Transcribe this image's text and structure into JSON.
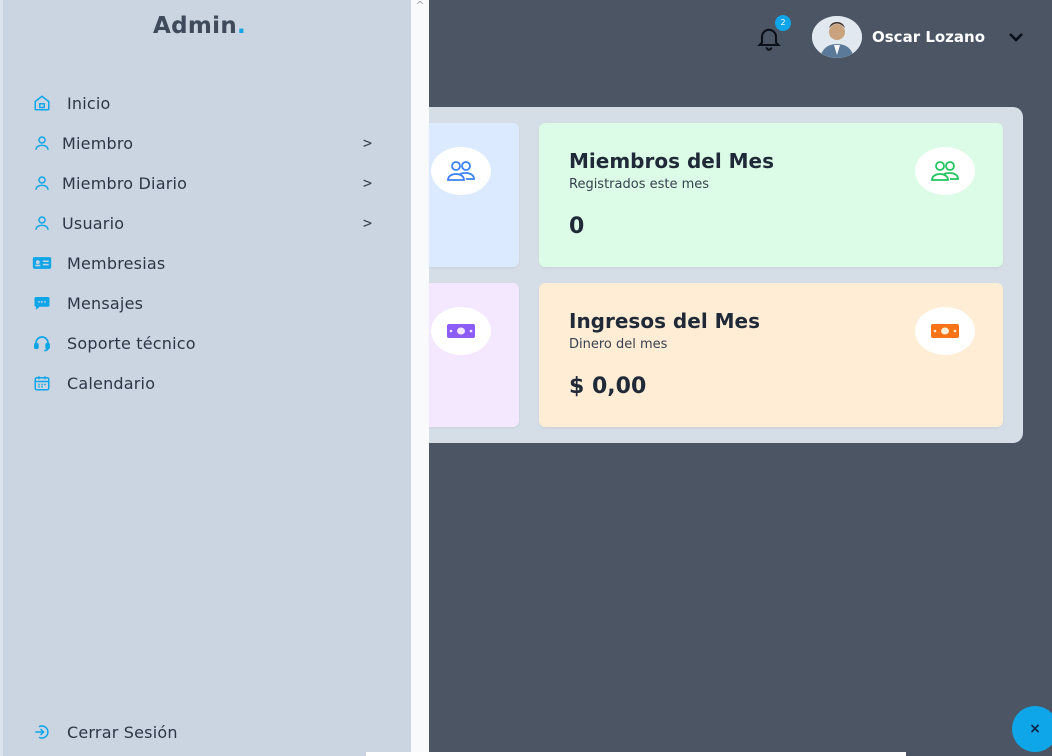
{
  "brand": {
    "name": "Admin",
    "dot": "."
  },
  "colors": {
    "accent": "#0ea5e9",
    "sidebar_bg": "#cbd5e1",
    "main_bg": "#4b5563",
    "card_blue": "#dbeafe",
    "card_green": "#dcfce7",
    "card_purple": "#f3e8ff",
    "card_orange": "#ffedd5"
  },
  "sidebar": {
    "items": [
      {
        "label": "Inicio",
        "icon": "home-icon"
      },
      {
        "label": "Miembro",
        "icon": "user-icon",
        "chevron": ">"
      },
      {
        "label": "Miembro Diario",
        "icon": "user-icon",
        "chevron": ">"
      },
      {
        "label": "Usuario",
        "icon": "user-icon",
        "chevron": ">"
      },
      {
        "label": "Membresias",
        "icon": "id-card-icon"
      },
      {
        "label": "Mensajes",
        "icon": "chat-icon"
      },
      {
        "label": "Soporte técnico",
        "icon": "headset-icon"
      },
      {
        "label": "Calendario",
        "icon": "calendar-icon"
      }
    ],
    "logout": {
      "label": "Cerrar Sesión",
      "icon": "logout-icon"
    }
  },
  "topbar": {
    "notifications": {
      "count": "2",
      "icon": "bell-icon"
    },
    "user": {
      "name": "Oscar Lozano",
      "icon": "chevron-down-icon"
    }
  },
  "cards": {
    "members_month": {
      "title": "Miembros del Mes",
      "subtitle": "Registrados este mes",
      "value": "0",
      "icon": "users-icon"
    },
    "income_month": {
      "title": "Ingresos del Mes",
      "subtitle": "Dinero del mes",
      "value": "$ 0,00",
      "icon": "money-icon"
    }
  },
  "fab": {
    "label": "×"
  }
}
